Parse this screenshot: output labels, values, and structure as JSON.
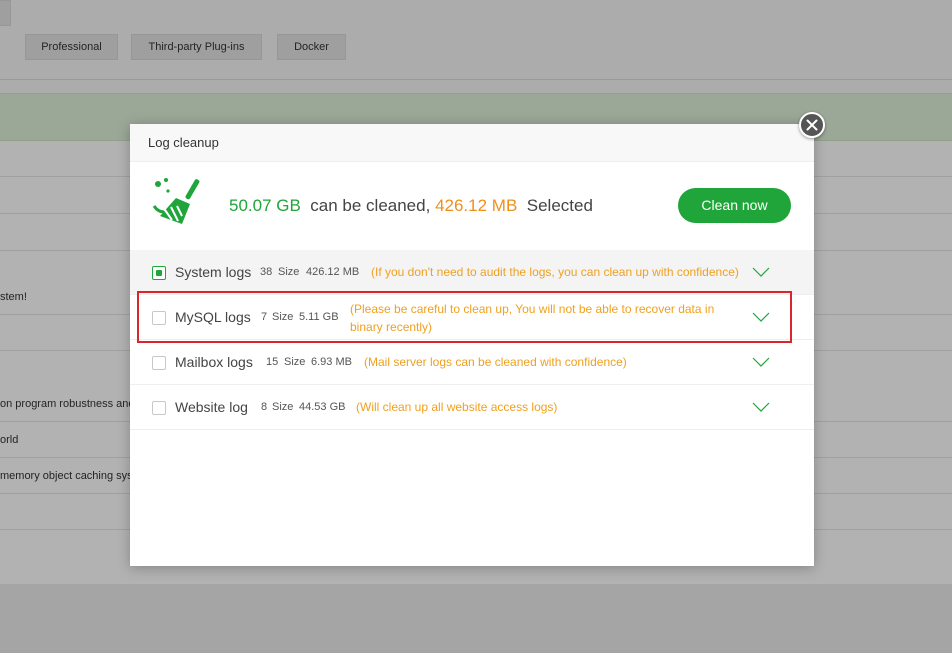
{
  "background": {
    "tabs": [
      "Professional",
      "Third-party Plug-ins",
      "Docker"
    ],
    "rows": [
      "stem!",
      "on program robustness and",
      "orld",
      "memory object caching syste"
    ]
  },
  "modal": {
    "title": "Log cleanup",
    "summary": {
      "total": "50.07 GB",
      "mid_text": "can be cleaned,",
      "selected": "426.12 MB",
      "end_text": "Selected"
    },
    "clean_button": "Clean now",
    "logs": [
      {
        "name": "System logs",
        "count": "38",
        "size_label": "Size",
        "size": "426.12 MB",
        "note": "(If you don't need to audit the logs, you can clean up with confidence)",
        "checked": true
      },
      {
        "name": "MySQL logs",
        "count": "7",
        "size_label": "Size",
        "size": "5.11 GB",
        "note": "(Please be careful to clean up, You will not be able to recover data in binary recently)",
        "checked": false
      },
      {
        "name": "Mailbox logs",
        "count": "15",
        "size_label": "Size",
        "size": "6.93 MB",
        "note": "(Mail server logs can be cleaned with confidence)",
        "checked": false
      },
      {
        "name": "Website log",
        "count": "8",
        "size_label": "Size",
        "size": "44.53 GB",
        "note": "(Will clean up all website access logs)",
        "checked": false
      }
    ]
  },
  "colors": {
    "accent": "#20a53a",
    "warning": "#f0a020",
    "highlight": "#d9262c"
  },
  "icons": [
    "broom-icon",
    "close-icon",
    "chevron-down-icon"
  ]
}
